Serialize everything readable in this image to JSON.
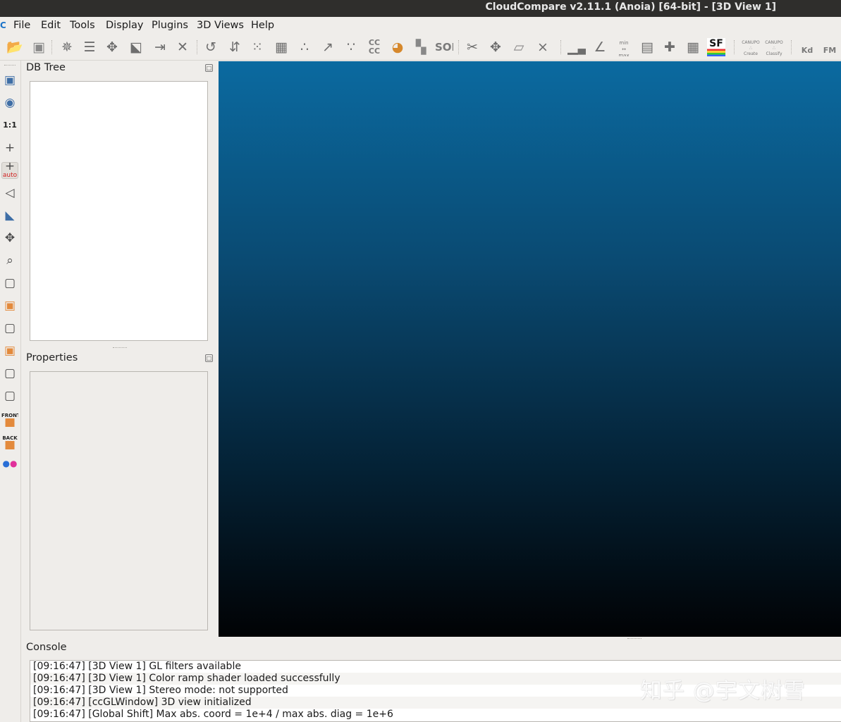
{
  "window": {
    "title": "CloudCompare v2.11.1 (Anoia) [64-bit] - [3D View 1]"
  },
  "menu": [
    {
      "label": "File"
    },
    {
      "label": "Edit"
    },
    {
      "label": "Tools"
    },
    {
      "label": "Display"
    },
    {
      "label": "Plugins"
    },
    {
      "label": "3D Views"
    },
    {
      "label": "Help"
    }
  ],
  "toolbar": {
    "icons": [
      "open-icon",
      "save-icon",
      "clone-icon",
      "list-icon",
      "merge-icon",
      "subsample-icon",
      "segment-icon",
      "delete-icon",
      "normals-icon",
      "orient-icon",
      "sample-icon",
      "mesh-icon",
      "sparse-icon",
      "scatter-icon",
      "noise-icon",
      "cc-icon",
      "bucket-icon",
      "checker-icon",
      "sor-icon",
      "scissors-icon",
      "translate-icon",
      "plane-icon",
      "pick-icon",
      "histogram-icon",
      "curve-icon",
      "minmax-icon",
      "delete-sf-icon",
      "add-sf-icon",
      "calculator-icon",
      "sf-icon",
      "canupo-create-icon",
      "canupo-classify-icon",
      "kd-icon",
      "fm-icon"
    ],
    "text_labels": {
      "cc": "CC",
      "cc2": "CC",
      "sor": "SOR",
      "min": "min",
      "max": "max",
      "sf": "SF",
      "canupo": "CANUPO",
      "create": "Create",
      "classify": "Classify",
      "kd": "Kd",
      "fm": "FM"
    }
  },
  "left_toolbar": {
    "scale_label": "1:1",
    "auto_label": "auto",
    "front_label": "FRONT",
    "back_label": "BACK"
  },
  "panels": {
    "db_tree": {
      "title": "DB Tree"
    },
    "properties": {
      "title": "Properties"
    },
    "console": {
      "title": "Console",
      "lines": [
        "[09:16:47] [3D View 1] GL filters available",
        "[09:16:47] [3D View 1] Color ramp shader loaded successfully",
        "[09:16:47] [3D View 1] Stereo mode: not supported",
        "[09:16:47] [ccGLWindow] 3D view initialized",
        "[09:16:47] [Global Shift] Max abs. coord = 1e+4 / max abs. diag = 1e+6"
      ]
    }
  },
  "watermark": "知乎 @宇文树雪",
  "colors": {
    "view_top": "#0b6aa0",
    "view_bottom": "#010204",
    "titlebar": "#2f2e2c",
    "window_bg": "#efedea"
  }
}
